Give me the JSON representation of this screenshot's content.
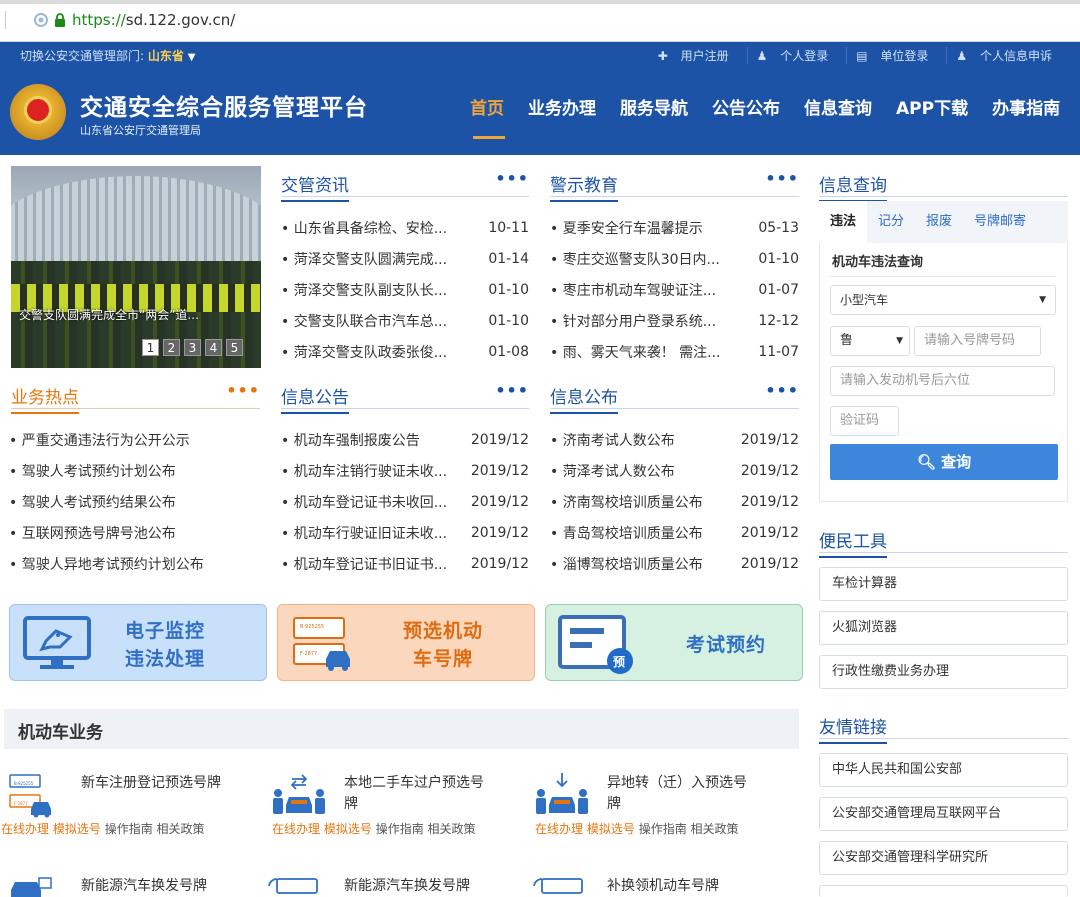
{
  "browser": {
    "url_scheme": "https://",
    "url_host": "sd.122.gov.cn/"
  },
  "topstrip": {
    "switch_label": "切换公安交通管理部门:",
    "province": "山东省",
    "links": [
      "用户注册",
      "个人登录",
      "单位登录",
      "个人信息申诉"
    ]
  },
  "header": {
    "title": "交通安全综合服务管理平台",
    "subtitle": "山东省公安厅交通管理局",
    "nav": [
      "首页",
      "业务办理",
      "服务导航",
      "公告公布",
      "信息查询",
      "APP下载",
      "办事指南"
    ]
  },
  "photo": {
    "caption": "交警支队圆满完成全市“两会”道...",
    "pages": [
      "1",
      "2",
      "3",
      "4",
      "5"
    ]
  },
  "sections": {
    "jgzx": {
      "title": "交管资讯",
      "more": "•••",
      "items": [
        {
          "t": "• 山东省具备综检、安检...",
          "d": "10-11"
        },
        {
          "t": "• 菏泽交警支队圆满完成...",
          "d": "01-14"
        },
        {
          "t": "• 菏泽交警支队副支队长...",
          "d": "01-10"
        },
        {
          "t": "• 交警支队联合市汽车总...",
          "d": "01-10"
        },
        {
          "t": "• 菏泽交警支队政委张俊...",
          "d": "01-08"
        }
      ]
    },
    "jsjy": {
      "title": "警示教育",
      "more": "•••",
      "items": [
        {
          "t": "• 夏季安全行车温馨提示",
          "d": "05-13"
        },
        {
          "t": "• 枣庄交巡警支队30日内...",
          "d": "01-10"
        },
        {
          "t": "• 枣庄市机动车驾驶证注...",
          "d": "01-07"
        },
        {
          "t": "• 针对部分用户登录系统...",
          "d": "12-12"
        },
        {
          "t": "• 雨、雾天气来袭！ 需注...",
          "d": "11-07"
        }
      ]
    },
    "ywrd": {
      "title": "业务热点",
      "more": "•••",
      "items": [
        "• 严重交通违法行为公开公示",
        "• 驾驶人考试预约计划公布",
        "• 驾驶人考试预约结果公布",
        "• 互联网预选号牌号池公布",
        "• 驾驶人异地考试预约计划公布"
      ]
    },
    "xxgg": {
      "title": "信息公告",
      "more": "•••",
      "items": [
        {
          "t": "• 机动车强制报废公告",
          "d": "2019/12"
        },
        {
          "t": "• 机动车注销行驶证未收...",
          "d": "2019/12"
        },
        {
          "t": "• 机动车登记证书未收回...",
          "d": "2019/12"
        },
        {
          "t": "• 机动车行驶证旧证未收...",
          "d": "2019/12"
        },
        {
          "t": "• 机动车登记证书旧证书...",
          "d": "2019/12"
        }
      ]
    },
    "xxgb": {
      "title": "信息公布",
      "more": "•••",
      "items": [
        {
          "t": "• 济南考试人数公布",
          "d": "2019/12"
        },
        {
          "t": "• 菏泽考试人数公布",
          "d": "2019/12"
        },
        {
          "t": "• 济南驾校培训质量公布",
          "d": "2019/12"
        },
        {
          "t": "• 青岛驾校培训质量公布",
          "d": "2019/12"
        },
        {
          "t": "• 淄博驾校培训质量公布",
          "d": "2019/12"
        }
      ]
    }
  },
  "banners": {
    "b1": {
      "l1": "电子监控",
      "l2": "违法处理"
    },
    "b2": {
      "l1": "预选机动",
      "l2": "车号牌",
      "plate1": "B·925255",
      "plate2": "F·2877"
    },
    "b3": {
      "l1": "考试预约",
      "badge": "预"
    }
  },
  "vehicle": {
    "title": "机动车业务",
    "items": [
      {
        "name": "新车注册登记预选号牌",
        "links": [
          "在线办理",
          "模拟选号",
          "操作指南",
          "相关政策"
        ],
        "plate1": "B·925255",
        "plate2": "F·2877"
      },
      {
        "name": "本地二手车过户预选号牌",
        "links": [
          "在线办理",
          "模拟选号",
          "操作指南",
          "相关政策"
        ]
      },
      {
        "name": "异地转（迁）入预选号牌",
        "links": [
          "在线办理",
          "模拟选号",
          "操作指南",
          "相关政策"
        ]
      },
      {
        "name": "新能源汽车换发号牌"
      },
      {
        "name": "新能源汽车换发号牌"
      },
      {
        "name": "补换领机动车号牌"
      }
    ]
  },
  "info_query": {
    "title": "信息查询",
    "tabs": [
      "违法",
      "记分",
      "报废",
      "号牌邮寄"
    ],
    "panel_title": "机动车违法查询",
    "car_type": "小型汽车",
    "province": "鲁",
    "plate_placeholder": "请输入号牌号码",
    "engine_placeholder": "请输入发动机号后六位",
    "captcha_placeholder": "验证码",
    "button": "查询"
  },
  "tools": {
    "title": "便民工具",
    "items": [
      "车检计算器",
      "火狐浏览器",
      "行政性缴费业务办理"
    ]
  },
  "links": {
    "title": "友情链接",
    "items": [
      "中华人民共和国公安部",
      "公安部交通管理局互联网平台",
      "公安部交通管理科学研究所"
    ]
  },
  "colors": {
    "primary": "#1d53a6",
    "accent": "#e5760e",
    "nav_active": "#f0a43c",
    "query_button": "#3c86dc"
  }
}
